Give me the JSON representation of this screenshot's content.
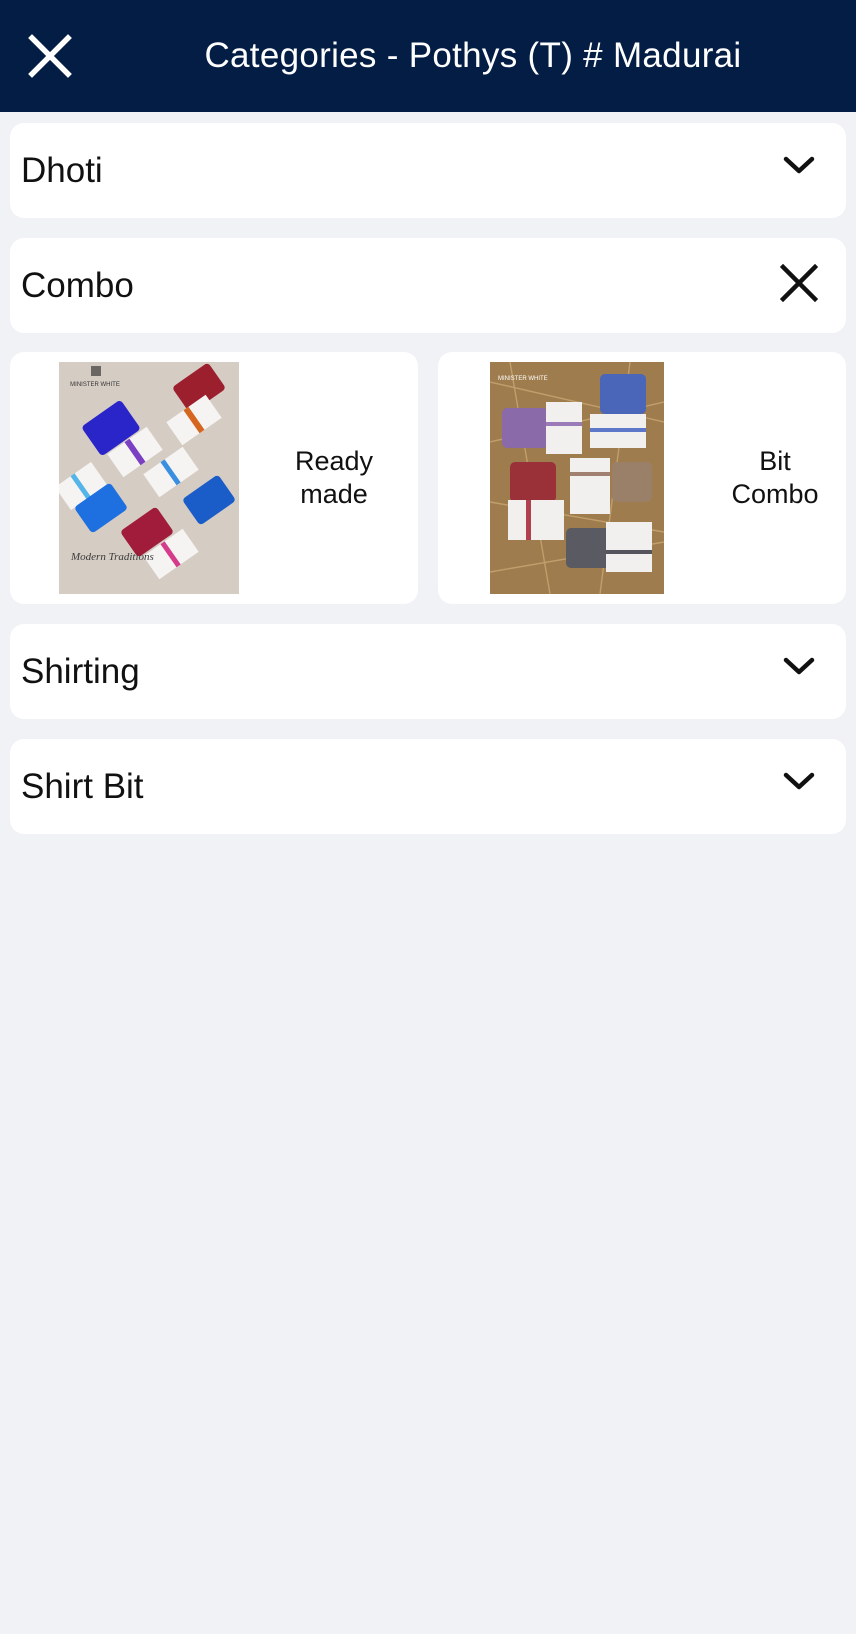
{
  "header": {
    "title": "Categories - Pothys (T) # Madurai",
    "close_icon": "close-icon",
    "background": "#031d45"
  },
  "categories": [
    {
      "label": "Dhoti",
      "state": "collapsed",
      "icon": "chevron-down-icon"
    },
    {
      "label": "Combo",
      "state": "expanded",
      "icon": "close-icon",
      "subcategories": [
        {
          "line1": "Ready",
          "line2": "made",
          "image": "product-thumbnail",
          "brand_text": "MINISTER WHITE",
          "script_text": "Modern Traditions"
        },
        {
          "line1": "Bit",
          "line2": "Combo",
          "image": "product-thumbnail",
          "brand_text": "MINISTER WHITE"
        }
      ]
    },
    {
      "label": "Shirting",
      "state": "collapsed",
      "icon": "chevron-down-icon"
    },
    {
      "label": "Shirt Bit",
      "state": "collapsed",
      "icon": "chevron-down-icon"
    }
  ],
  "colors": {
    "page_background": "#f0f2f6",
    "card_background": "#ffffff",
    "text": "#111111"
  }
}
